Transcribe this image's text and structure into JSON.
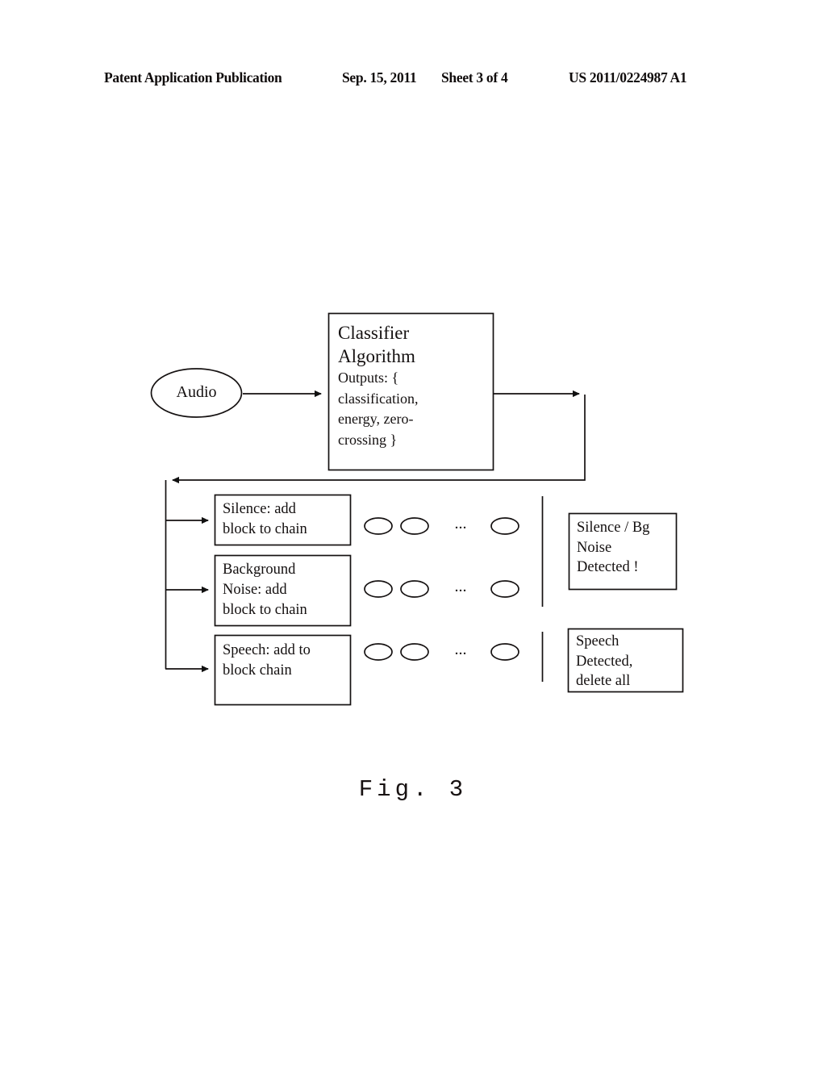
{
  "header": {
    "publication": "Patent Application Publication",
    "date": "Sep. 15, 2011",
    "sheet": "Sheet 3 of 4",
    "patent_number": "US 2011/0224987 A1"
  },
  "figure": {
    "caption": "Fig.  3",
    "source_node": {
      "label": "Audio",
      "shape": "ellipse"
    },
    "classifier": {
      "title": "Classifier\nAlgorithm",
      "outputs": "Outputs: {\nclassification,\nenergy, zero-\ncrossing }"
    },
    "process_boxes": [
      {
        "label": "Silence: add\nblock to chain"
      },
      {
        "label": "Background\nNoise: add\nblock to chain"
      },
      {
        "label": "Speech: add to\nblock chain"
      }
    ],
    "chains": [
      {
        "ellipse_count": 3,
        "ellipsis": "..."
      },
      {
        "ellipse_count": 3,
        "ellipsis": "..."
      },
      {
        "ellipse_count": 3,
        "ellipsis": "..."
      }
    ],
    "result_boxes": [
      {
        "label": "Silence / Bg\nNoise\nDetected !"
      },
      {
        "label": "Speech\nDetected,\ndelete all"
      }
    ],
    "colors": {
      "ink": "#141010",
      "background": "#ffffff"
    }
  }
}
